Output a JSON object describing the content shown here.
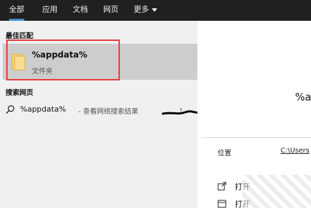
{
  "tabs": [
    {
      "label": "全部",
      "active": true
    },
    {
      "label": "应用"
    },
    {
      "label": "文档"
    },
    {
      "label": "网页"
    },
    {
      "label": "更多"
    }
  ],
  "sections": {
    "best_match_title": "最佳匹配",
    "web_title": "搜索网页"
  },
  "best_match": {
    "name": "%appdata%",
    "type": "文件夹",
    "icon": "folder-icon"
  },
  "web_result": {
    "query": "%appdata%",
    "suffix": "- 查看网络搜索结果",
    "icon": "search-icon",
    "chevron": "›"
  },
  "preview": {
    "name": "%a",
    "location_label": "位置",
    "location_value": "C:\\Users",
    "actions": [
      {
        "label": "打开",
        "icon": "open-icon"
      },
      {
        "label": "打开",
        "icon": "open-file-location-icon"
      }
    ]
  },
  "colors": {
    "tabbar_bg": "#202020",
    "accent": "#3c8fd6",
    "selection_bg": "#cdcdcd",
    "highlight_border": "#e53b3b"
  }
}
